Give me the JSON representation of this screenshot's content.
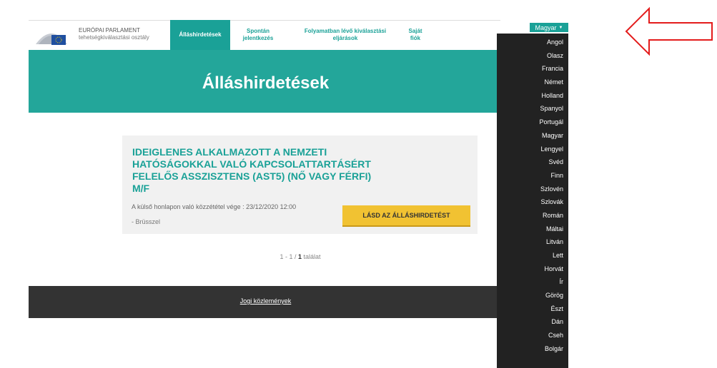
{
  "header": {
    "org_line1": "EURÓPAI PARLAMENT",
    "org_line2": "tehetségkiválasztási osztály",
    "nav": [
      {
        "label": "Álláshirdetések",
        "active": true
      },
      {
        "label": "Spontán jelentkezés",
        "active": false
      },
      {
        "label": "Folyamatban lévő kiválasztási eljárások",
        "active": false
      },
      {
        "label": "Saját fiók",
        "active": false
      }
    ]
  },
  "hero": {
    "title": "Álláshirdetések"
  },
  "job": {
    "title": "IDEIGLENES ALKALMAZOTT A NEMZETI HATÓSÁGOKKAL VALÓ KAPCSOLATTARTÁSÉRT FELELŐS ASSZISZTENS (AST5) (NŐ VAGY FÉRFI) M/F",
    "deadline": "A külső honlapon való közzététel vége : 23/12/2020 12:00",
    "location": "- Brüsszel",
    "cta": "LÁSD AZ ÁLLÁSHIRDETÉST"
  },
  "pagination": {
    "range": "1 - 1 /",
    "total": "1",
    "suffix": "találat"
  },
  "footer": {
    "link": "Jogi közlemények"
  },
  "language": {
    "selected": "Magyar",
    "options": [
      "Angol",
      "Olasz",
      "Francia",
      "Német",
      "Holland",
      "Spanyol",
      "Portugál",
      "Magyar",
      "Lengyel",
      "Svéd",
      "Finn",
      "Szlovén",
      "Szlovák",
      "Román",
      "Máltai",
      "Litván",
      "Lett",
      "Horvát",
      "Ír",
      "Görög",
      "Észt",
      "Dán",
      "Cseh",
      "Bolgár"
    ]
  },
  "colors": {
    "accent": "#1aa197",
    "hero": "#23a69a",
    "cta": "#f1c232",
    "dropdown": "#222222",
    "annotation_arrow": "#e31b1b"
  },
  "icons": {
    "logo": "european-parliament-logo",
    "caret": "caret-down-icon",
    "annotation": "red-arrow-left"
  }
}
